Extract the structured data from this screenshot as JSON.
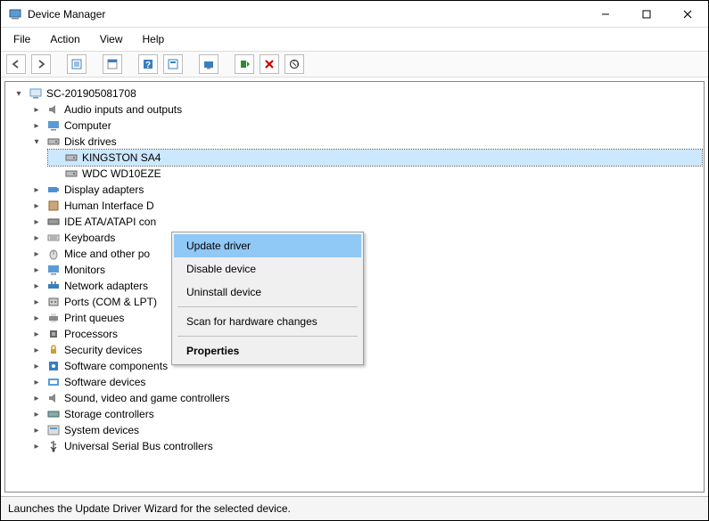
{
  "window": {
    "title": "Device Manager"
  },
  "menubar": {
    "file": "File",
    "action": "Action",
    "view": "View",
    "help": "Help"
  },
  "toolbar": {
    "back": "back",
    "forward": "forward",
    "detail": "detail",
    "properties": "properties",
    "help": "help",
    "search": "search",
    "showhidden": "show",
    "update": "update",
    "uninstall": "uninstall",
    "scan": "scan"
  },
  "tree": {
    "root": "SC-201905081708",
    "audio": "Audio inputs and outputs",
    "computer": "Computer",
    "disk": "Disk drives",
    "disk_child1": "KINGSTON SA4",
    "disk_child2": "WDC WD10EZE",
    "display": "Display adapters",
    "hid": "Human Interface D",
    "ide": "IDE ATA/ATAPI con",
    "keyboards": "Keyboards",
    "mice": "Mice and other po",
    "monitors": "Monitors",
    "network": "Network adapters",
    "ports": "Ports (COM & LPT)",
    "print": "Print queues",
    "processors": "Processors",
    "security": "Security devices",
    "softcomp": "Software components",
    "softdev": "Software devices",
    "sound": "Sound, video and game controllers",
    "storage": "Storage controllers",
    "system": "System devices",
    "usb": "Universal Serial Bus controllers"
  },
  "context": {
    "update": "Update driver",
    "disable": "Disable device",
    "uninstall": "Uninstall device",
    "scan": "Scan for hardware changes",
    "properties": "Properties"
  },
  "statusbar": {
    "text": "Launches the Update Driver Wizard for the selected device."
  }
}
